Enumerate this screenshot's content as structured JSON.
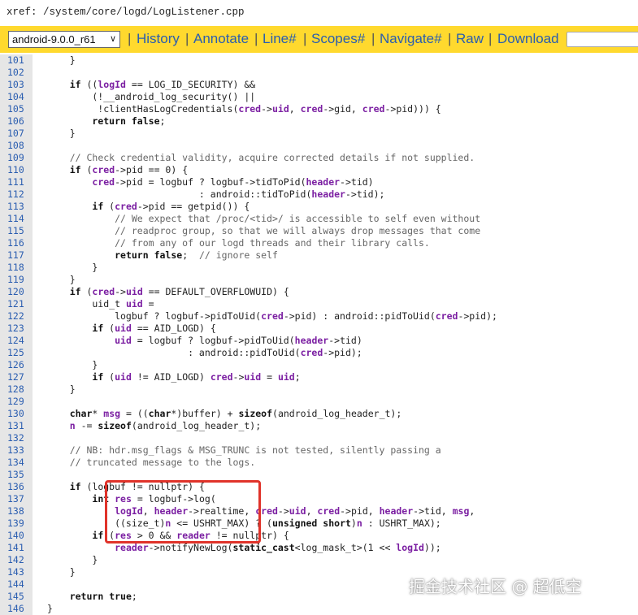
{
  "header": {
    "xref_path": "xref: /system/core/logd/LogListener.cpp"
  },
  "nav": {
    "branch_select": "android-9.0.0_r61",
    "links": [
      "History",
      "Annotate",
      "Line#",
      "Scopes#",
      "Navigate#",
      "Raw",
      "Download"
    ],
    "search_value": ""
  },
  "code": {
    "lines": [
      {
        "n": "101",
        "t": "        }"
      },
      {
        "n": "102",
        "t": ""
      },
      {
        "n": "103",
        "t": "        if ((logId == LOG_ID_SECURITY) &&"
      },
      {
        "n": "104",
        "t": "            (!__android_log_security() ||"
      },
      {
        "n": "105",
        "t": "             !clientHasLogCredentials(cred->uid, cred->gid, cred->pid))) {"
      },
      {
        "n": "106",
        "t": "            return false;"
      },
      {
        "n": "107",
        "t": "        }"
      },
      {
        "n": "108",
        "t": ""
      },
      {
        "n": "109",
        "t": "        // Check credential validity, acquire corrected details if not supplied."
      },
      {
        "n": "110",
        "t": "        if (cred->pid == 0) {"
      },
      {
        "n": "111",
        "t": "            cred->pid = logbuf ? logbuf->tidToPid(header->tid)"
      },
      {
        "n": "112",
        "t": "                               : android::tidToPid(header->tid);"
      },
      {
        "n": "113",
        "t": "            if (cred->pid == getpid()) {"
      },
      {
        "n": "114",
        "t": "                // We expect that /proc/<tid>/ is accessible to self even without"
      },
      {
        "n": "115",
        "t": "                // readproc group, so that we will always drop messages that come"
      },
      {
        "n": "116",
        "t": "                // from any of our logd threads and their library calls."
      },
      {
        "n": "117",
        "t": "                return false;  // ignore self"
      },
      {
        "n": "118",
        "t": "            }"
      },
      {
        "n": "119",
        "t": "        }"
      },
      {
        "n": "120",
        "t": "        if (cred->uid == DEFAULT_OVERFLOWUID) {"
      },
      {
        "n": "121",
        "t": "            uid_t uid ="
      },
      {
        "n": "122",
        "t": "                logbuf ? logbuf->pidToUid(cred->pid) : android::pidToUid(cred->pid);"
      },
      {
        "n": "123",
        "t": "            if (uid == AID_LOGD) {"
      },
      {
        "n": "124",
        "t": "                uid = logbuf ? logbuf->pidToUid(header->tid)"
      },
      {
        "n": "125",
        "t": "                             : android::pidToUid(cred->pid);"
      },
      {
        "n": "126",
        "t": "            }"
      },
      {
        "n": "127",
        "t": "            if (uid != AID_LOGD) cred->uid = uid;"
      },
      {
        "n": "128",
        "t": "        }"
      },
      {
        "n": "129",
        "t": ""
      },
      {
        "n": "130",
        "t": "        char* msg = ((char*)buffer) + sizeof(android_log_header_t);"
      },
      {
        "n": "131",
        "t": "        n -= sizeof(android_log_header_t);"
      },
      {
        "n": "132",
        "t": ""
      },
      {
        "n": "133",
        "t": "        // NB: hdr.msg_flags & MSG_TRUNC is not tested, silently passing a"
      },
      {
        "n": "134",
        "t": "        // truncated message to the logs."
      },
      {
        "n": "135",
        "t": ""
      },
      {
        "n": "136",
        "t": "        if (logbuf != nullptr) {"
      },
      {
        "n": "137",
        "t": "            int res = logbuf->log("
      },
      {
        "n": "138",
        "t": "                logId, header->realtime, cred->uid, cred->pid, header->tid, msg,"
      },
      {
        "n": "139",
        "t": "                ((size_t)n <= USHRT_MAX) ? (unsigned short)n : USHRT_MAX);"
      },
      {
        "n": "140",
        "t": "            if (res > 0 && reader != nullptr) {"
      },
      {
        "n": "141",
        "t": "                reader->notifyNewLog(static_cast<log_mask_t>(1 << logId));"
      },
      {
        "n": "142",
        "t": "            }"
      },
      {
        "n": "143",
        "t": "        }"
      },
      {
        "n": "144",
        "t": ""
      },
      {
        "n": "145",
        "t": "        return true;"
      },
      {
        "n": "146",
        "t": "    }"
      }
    ]
  },
  "watermark": "掘金技术社区 @ 超低空",
  "colors": {
    "nav_bg": "#ffd92e",
    "link": "#2a5db0",
    "highlight": "#e0332a",
    "gutter": "#e6e6e6"
  }
}
